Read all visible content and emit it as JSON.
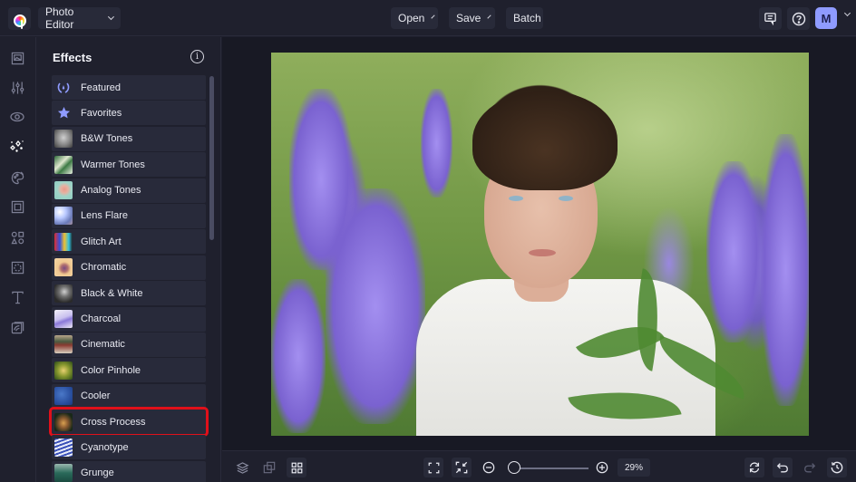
{
  "topbar": {
    "app_menu_label": "Photo Editor",
    "open_label": "Open",
    "save_label": "Save",
    "batch_label": "Batch",
    "feedback_icon": "message-square-icon",
    "help_icon": "question-circle-icon",
    "avatar_initial": "M"
  },
  "rail": {
    "items": [
      {
        "name": "image",
        "icon": "image-icon"
      },
      {
        "name": "adjust",
        "icon": "sliders-icon"
      },
      {
        "name": "touch-up",
        "icon": "eye-icon"
      },
      {
        "name": "effects",
        "icon": "sparkles-icon",
        "active": true
      },
      {
        "name": "artsy",
        "icon": "palette-icon"
      },
      {
        "name": "frames",
        "icon": "frame-icon"
      },
      {
        "name": "graphics",
        "icon": "shapes-icon"
      },
      {
        "name": "overlays",
        "icon": "overlay-icon"
      },
      {
        "name": "text",
        "icon": "text-icon"
      },
      {
        "name": "textures",
        "icon": "texture-icon"
      }
    ]
  },
  "panel": {
    "title": "Effects",
    "items": [
      {
        "label": "Featured",
        "icon": "laurel-icon"
      },
      {
        "label": "Favorites",
        "icon": "star-icon"
      },
      {
        "label": "B&W Tones"
      },
      {
        "label": "Warmer Tones"
      },
      {
        "label": "Analog Tones"
      },
      {
        "label": "Lens Flare"
      },
      {
        "label": "Glitch Art"
      },
      {
        "label": "Chromatic"
      },
      {
        "label": "Black & White"
      },
      {
        "label": "Charcoal"
      },
      {
        "label": "Cinematic"
      },
      {
        "label": "Color Pinhole"
      },
      {
        "label": "Cooler"
      },
      {
        "label": "Cross Process",
        "highlighted": true
      },
      {
        "label": "Cyanotype"
      },
      {
        "label": "Grunge"
      }
    ]
  },
  "bottombar": {
    "zoom_percent": "29%",
    "zoom_slider_fraction": 0.05
  },
  "colors": {
    "accent": "#8f9bff",
    "highlight": "#e0101a",
    "background": "#1f202d",
    "item_bg": "#282a3a"
  }
}
